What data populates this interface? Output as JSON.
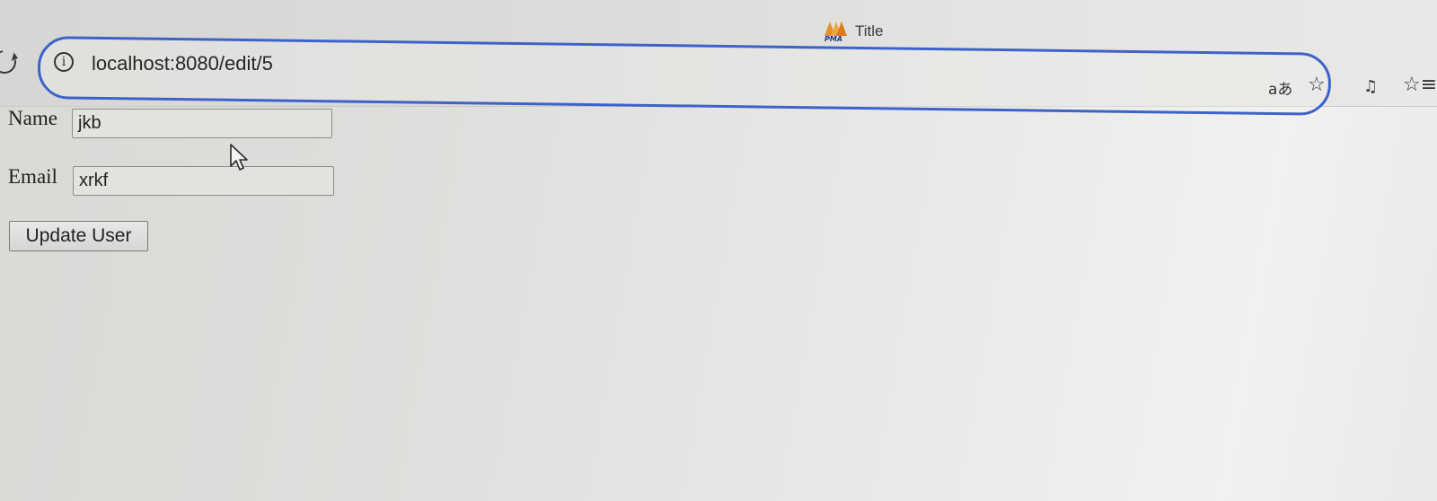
{
  "browser": {
    "tab_title": "Title",
    "favicon_text": "PMA",
    "url": "localhost:8080/edit/5",
    "info_icon": "info-icon",
    "reload_icon": "reload-icon",
    "translate_glyph": "aあ",
    "star_glyph": "☆",
    "reading_glyph": "♫",
    "favorites_glyph": "☆≡"
  },
  "form": {
    "name_label": "Name",
    "name_value": "jkb",
    "email_label": "Email",
    "email_value": "xrkf",
    "submit_label": "Update User"
  },
  "colors": {
    "focus_ring": "#3d63c9"
  }
}
